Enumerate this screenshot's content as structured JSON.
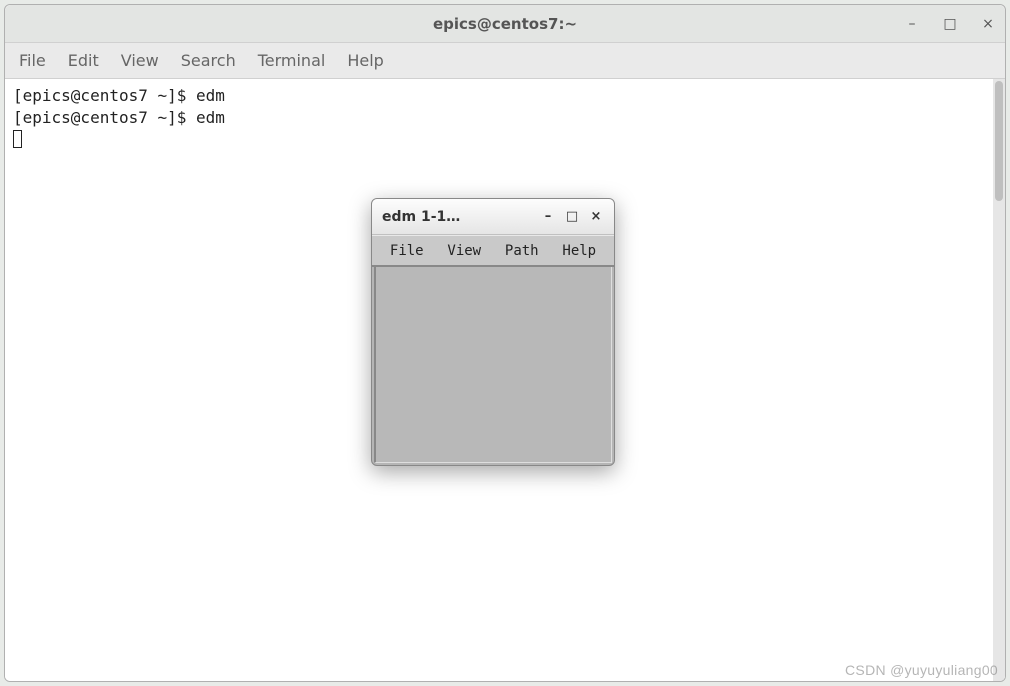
{
  "terminal": {
    "title": "epics@centos7:~",
    "menu": {
      "file": "File",
      "edit": "Edit",
      "view": "View",
      "search": "Search",
      "terminal": "Terminal",
      "help": "Help"
    },
    "lines": [
      "[epics@centos7 ~]$ edm",
      "[epics@centos7 ~]$ edm"
    ],
    "window_controls": {
      "minimize": "–",
      "maximize": "□",
      "close": "×"
    }
  },
  "edm": {
    "title": "edm 1-1…",
    "menu": {
      "file": "File",
      "view": "View",
      "path": "Path",
      "help": "Help"
    },
    "window_controls": {
      "minimize": "–",
      "maximize": "□",
      "close": "×"
    }
  },
  "watermark": "CSDN @yuyuyuliang00"
}
